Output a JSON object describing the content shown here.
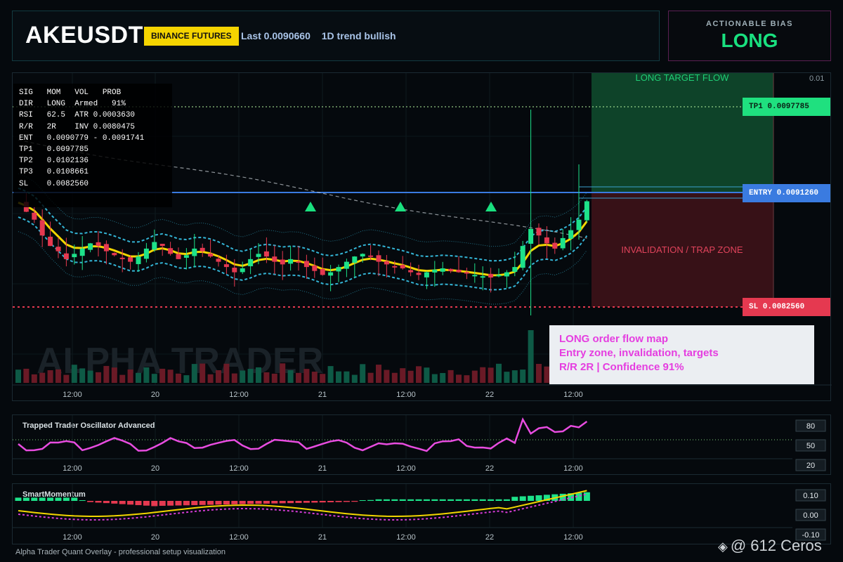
{
  "header": {
    "symbol": "AKEUSDT",
    "exchange": "BINANCE FUTURES",
    "last": "Last 0.0090660",
    "trend": "1D trend bullish"
  },
  "bias": {
    "label": "ACTIONABLE BIAS",
    "value": "LONG"
  },
  "stats": {
    "lines": [
      "SIG   MOM   VOL   PROB",
      "DIR   LONG  Armed   91%",
      "RSI   62.5  ATR 0.0003630",
      "R/R   2R    INV 0.0080475",
      "",
      "ENT   0.0090779 - 0.0091741",
      "TP1   0.0097785",
      "TP2   0.0102136",
      "TP3   0.0108661",
      "SL    0.0082560"
    ]
  },
  "levels": {
    "tp1": "TP1 0.0097785",
    "entry": "ENTRY 0.0091260",
    "sl": "SL 0.0082560",
    "axis_top": "0.01"
  },
  "zones": {
    "target": "LONG TARGET FLOW",
    "invalidation": "INVALIDATION / TRAP ZONE"
  },
  "watermark": "ALPHA TRADER",
  "callout": {
    "lines": [
      "LONG order flow map",
      "Entry zone, invalidation, targets",
      "R/R 2R | Confidence 91%"
    ]
  },
  "time_axis": [
    "12:00",
    "20",
    "12:00",
    "21",
    "12:00",
    "22",
    "12:00"
  ],
  "oscillator": {
    "title": "Trapped Trader Oscillator Advanced",
    "ticks": [
      "80",
      "50",
      "20"
    ]
  },
  "momentum": {
    "title": "SmartMomentum",
    "ticks": [
      "0.10",
      "0.00",
      "-0.10"
    ]
  },
  "footer": "Alpha Trader Quant Overlay - professional setup visualization",
  "credit": "@ 612 Ceros",
  "colors": {
    "bull": "#1de28a",
    "bear": "#e53950",
    "ema": "#f2d600",
    "band": "#34b5d6",
    "osc": "#e84ce0",
    "tp": "#19e07f",
    "entry": "#3a7be0",
    "sl": "#e53950"
  },
  "chart_data": {
    "type": "candlestick",
    "series_close": [
      0.00905,
      0.00898,
      0.00892,
      0.0088,
      0.00872,
      0.00868,
      0.00862,
      0.00866,
      0.0087,
      0.00874,
      0.00872,
      0.00868,
      0.00865,
      0.00862,
      0.0086,
      0.00864,
      0.0087,
      0.00875,
      0.00872,
      0.00866,
      0.00862,
      0.00865,
      0.0087,
      0.00868,
      0.00864,
      0.0086,
      0.00856,
      0.00852,
      0.00855,
      0.00862,
      0.00866,
      0.00864,
      0.0086,
      0.00858,
      0.00862,
      0.0086,
      0.00856,
      0.00853,
      0.0085,
      0.00852,
      0.00856,
      0.0086,
      0.00864,
      0.00866,
      0.00864,
      0.0086,
      0.00858,
      0.00856,
      0.00855,
      0.00852,
      0.0085,
      0.00852,
      0.00854,
      0.00855,
      0.00853,
      0.00852,
      0.00851,
      0.0085,
      0.00849,
      0.00848,
      0.0085,
      0.00852,
      0.00856,
      0.00872,
      0.00885,
      0.0088,
      0.00874,
      0.0087,
      0.00878,
      0.00884,
      0.00892,
      0.00906
    ],
    "levels": {
      "tp1": 0.0097785,
      "entry": 0.009126,
      "sl": 0.008256
    }
  }
}
